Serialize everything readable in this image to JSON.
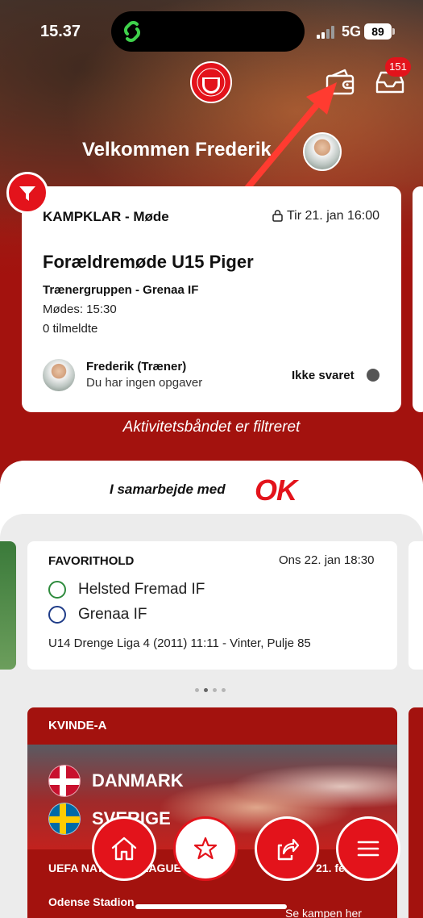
{
  "status_bar": {
    "time": "15.37",
    "network": "5G",
    "battery": "89"
  },
  "header": {
    "welcome": "Velkommen Frederik",
    "notification_count": "151"
  },
  "activity": {
    "type": "KAMPKLAR - Møde",
    "date": "Tir 21. jan 16:00",
    "title": "Forældremøde U15 Piger",
    "group": "Trænergruppen - Grenaa IF",
    "meeting_time": "Mødes: 15:30",
    "registered": "0 tilmeldte",
    "person": "Frederik (Træner)",
    "tasks": "Du har ingen opgaver",
    "response_status": "Ikke svaret"
  },
  "filter_note": "Aktivitetsbåndet er filtreret",
  "sponsor": {
    "text": "I samarbejde med",
    "logo": "OK"
  },
  "match": {
    "label": "FAVORITHOLD",
    "date": "Ons 22. jan 18:30",
    "home_team": "Helsted Fremad IF",
    "away_team": "Grenaa IF",
    "league": "U14 Drenge Liga 4 (2011) 11:11 - Vinter, Pulje 85"
  },
  "national_team": {
    "label": "KVINDE-A",
    "team1": "DANMARK",
    "team2": "SVERIGE",
    "league": "UEFA NATIONS LEAGUE",
    "date": "21. feb",
    "stadium": "Odense Stadion",
    "watch": "Se kampen her"
  },
  "nav": [
    "home-icon",
    "star-icon",
    "share-icon",
    "menu-icon"
  ],
  "colors": {
    "brand_red": "#e3131b",
    "band_red": "#a3120e",
    "panel_grey": "#ececec"
  }
}
